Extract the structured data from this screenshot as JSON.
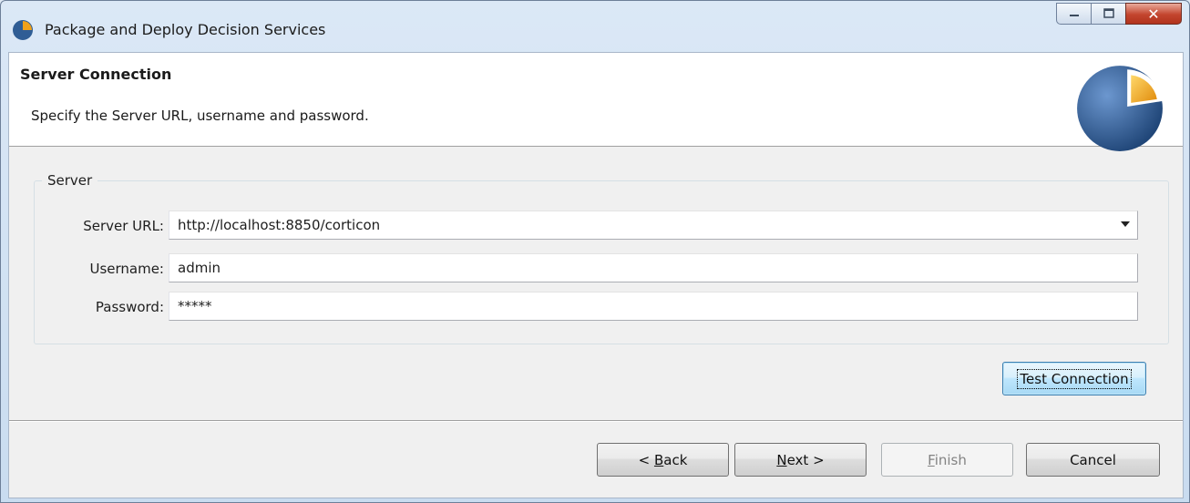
{
  "window": {
    "title": "Package and Deploy Decision Services"
  },
  "header": {
    "title": "Server Connection",
    "description": "Specify the Server URL, username and password."
  },
  "server_group": {
    "label": "Server",
    "server_url": {
      "label": "Server URL:",
      "value": "http://localhost:8850/corticon"
    },
    "username": {
      "label": "Username:",
      "value": "admin"
    },
    "password": {
      "label": "Password:",
      "value": "*****"
    }
  },
  "buttons": {
    "test_connection": "Test Connection",
    "back_prefix": "< ",
    "back_mnemonic": "B",
    "back_rest": "ack",
    "next_mnemonic": "N",
    "next_rest": "ext >",
    "finish_mnemonic": "F",
    "finish_rest": "inish",
    "cancel": "Cancel"
  },
  "colors": {
    "close_button": "#c3452e",
    "logo_blue": "#2f5d95",
    "logo_orange": "#f0a11a"
  }
}
